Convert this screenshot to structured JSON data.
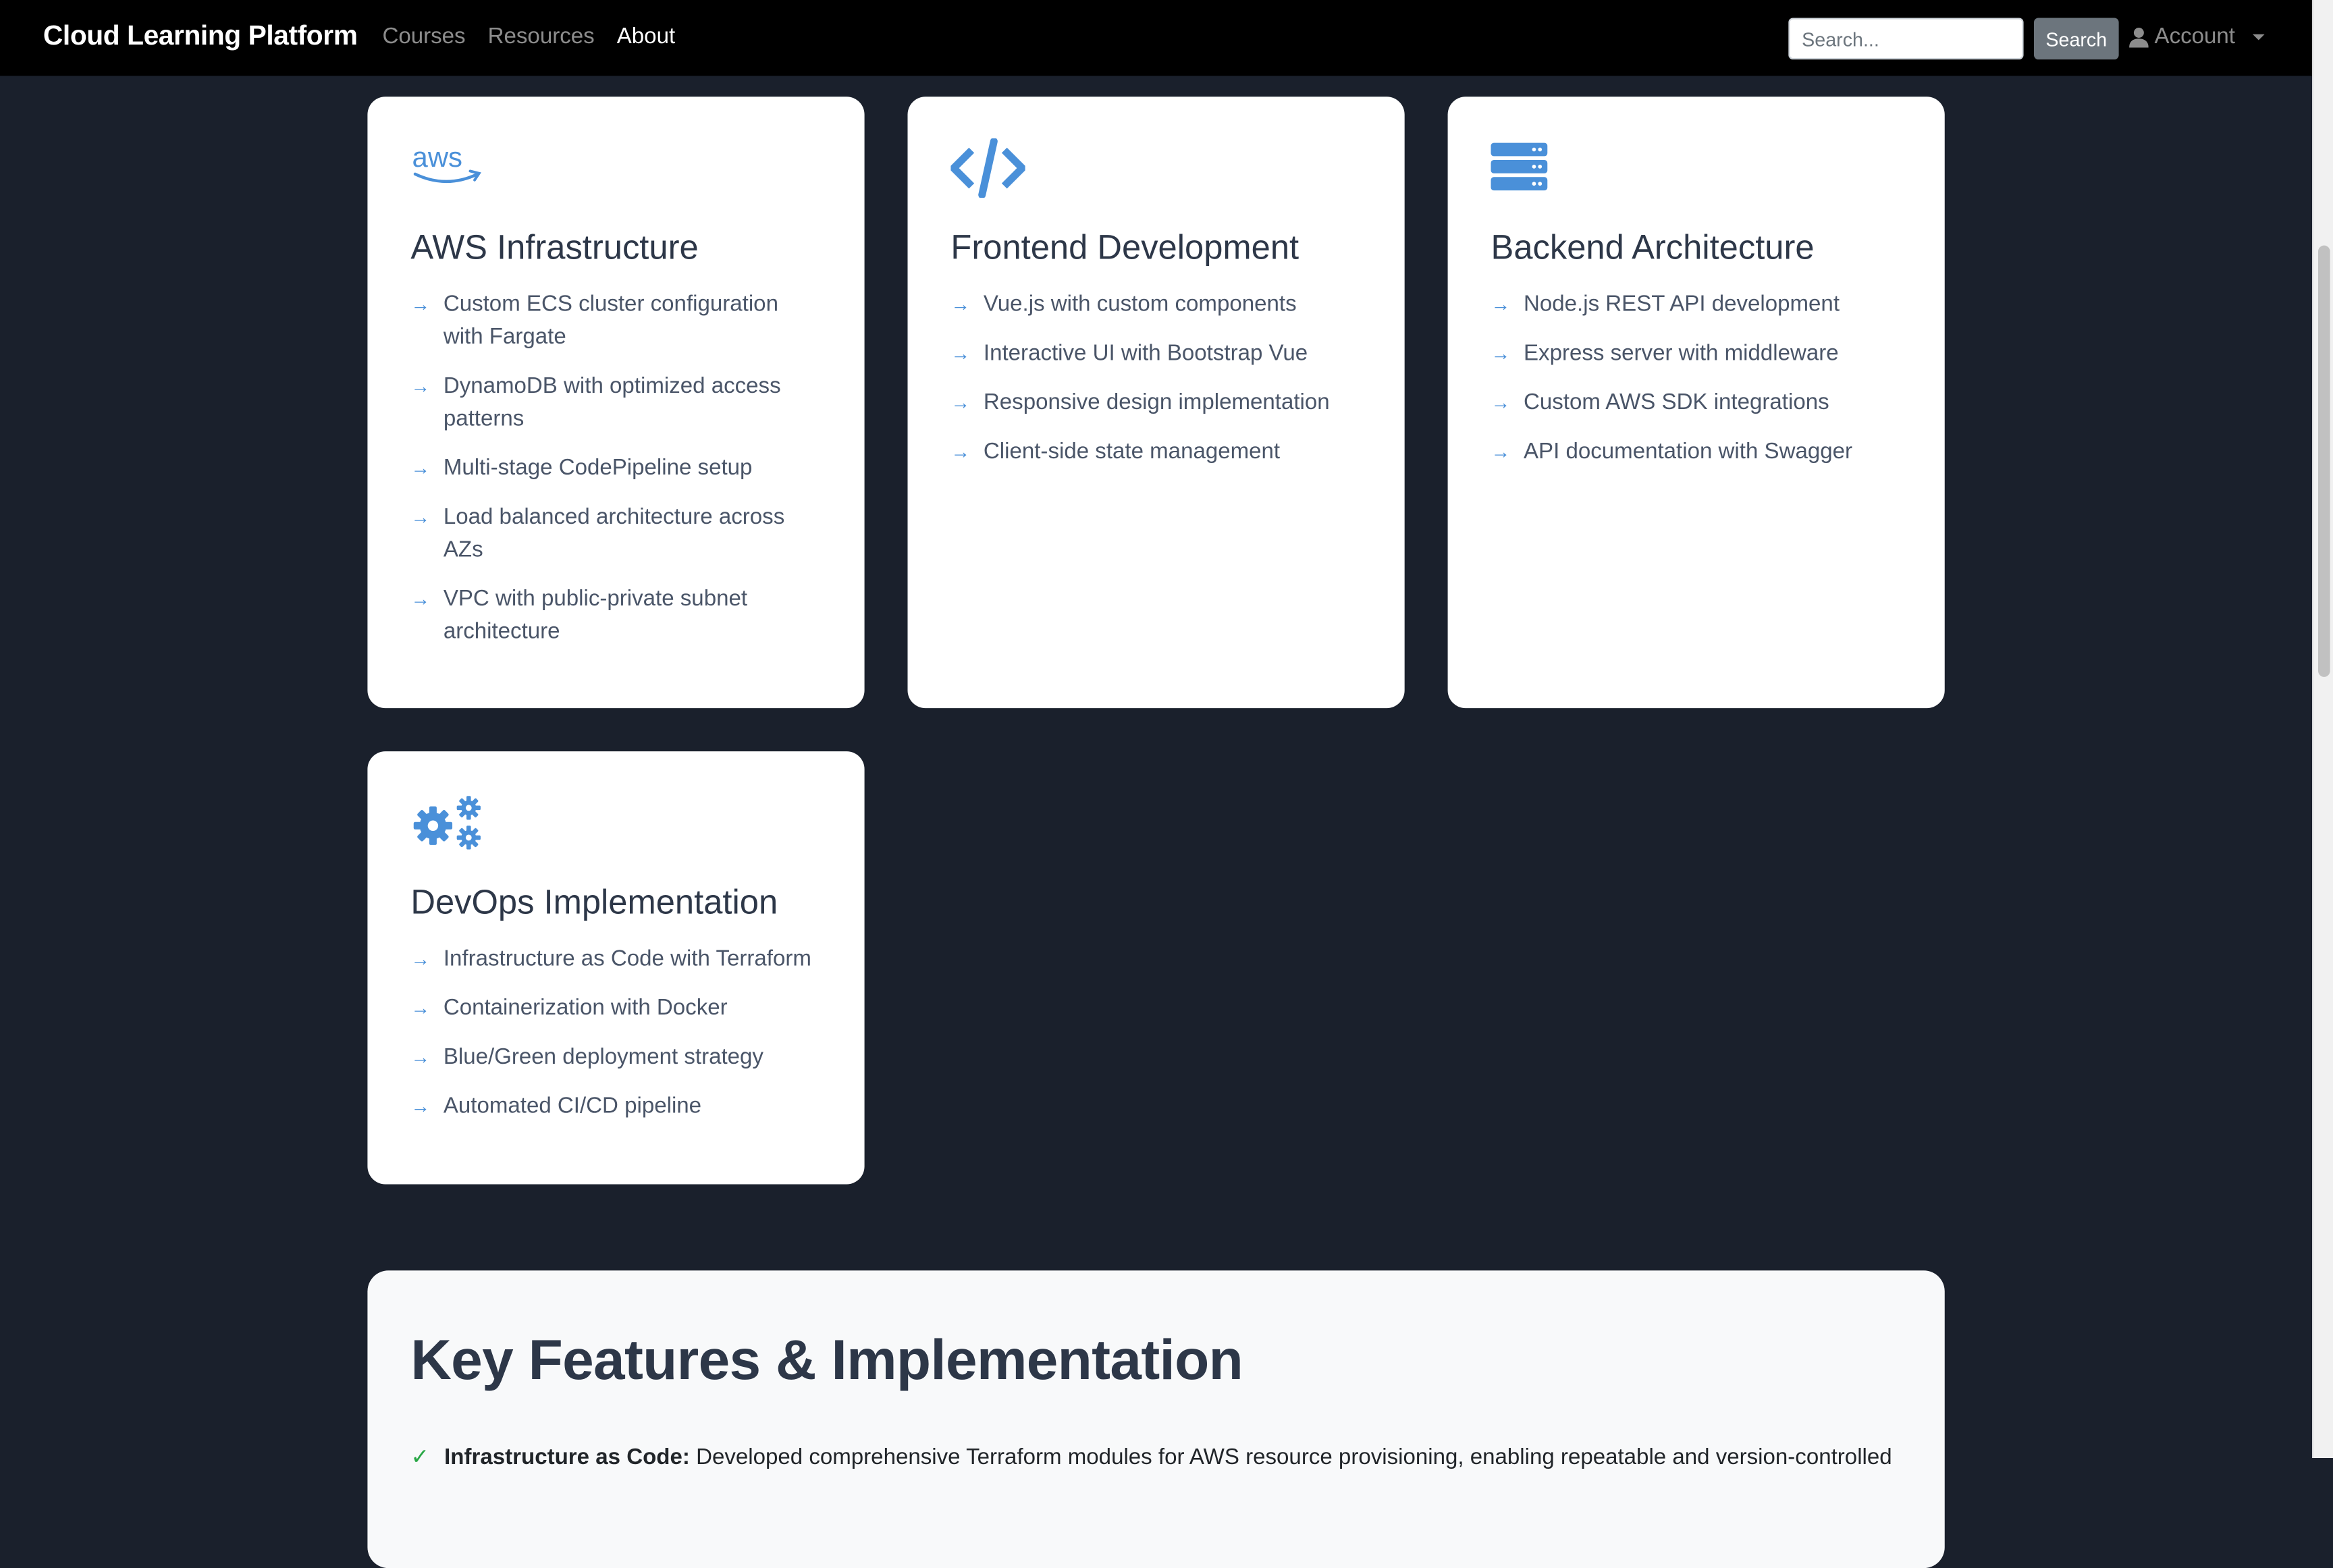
{
  "navbar": {
    "brand": "Cloud Learning Platform",
    "links": [
      "Courses",
      "Resources",
      "About"
    ],
    "search_placeholder": "Search...",
    "search_button": "Search",
    "account_label": "Account"
  },
  "cards": [
    {
      "icon": "aws-logo-icon",
      "title": "AWS Infrastructure",
      "items": [
        "Custom ECS cluster configuration with Fargate",
        "DynamoDB with optimized access patterns",
        "Multi-stage CodePipeline setup",
        "Load balanced architecture across AZs",
        "VPC with public-private subnet architecture"
      ]
    },
    {
      "icon": "code-icon",
      "title": "Frontend Development",
      "items": [
        "Vue.js with custom components",
        "Interactive UI with Bootstrap Vue",
        "Responsive design implementation",
        "Client-side state management"
      ]
    },
    {
      "icon": "server-icon",
      "title": "Backend Architecture",
      "items": [
        "Node.js REST API development",
        "Express server with middleware",
        "Custom AWS SDK integrations",
        "API documentation with Swagger"
      ]
    },
    {
      "icon": "cogs-icon",
      "title": "DevOps Implementation",
      "items": [
        "Infrastructure as Code with Terraform",
        "Containerization with Docker",
        "Blue/Green deployment strategy",
        "Automated CI/CD pipeline"
      ]
    }
  ],
  "features": {
    "title": "Key Features & Implementation",
    "first_item_label": "Infrastructure as Code:",
    "first_item_text": "Developed comprehensive Terraform modules for AWS resource provisioning, enabling repeatable and version-controlled"
  },
  "colors": {
    "page_bg": "#1a202c",
    "navbar_bg": "#000000",
    "accent": "#4a90d9"
  }
}
